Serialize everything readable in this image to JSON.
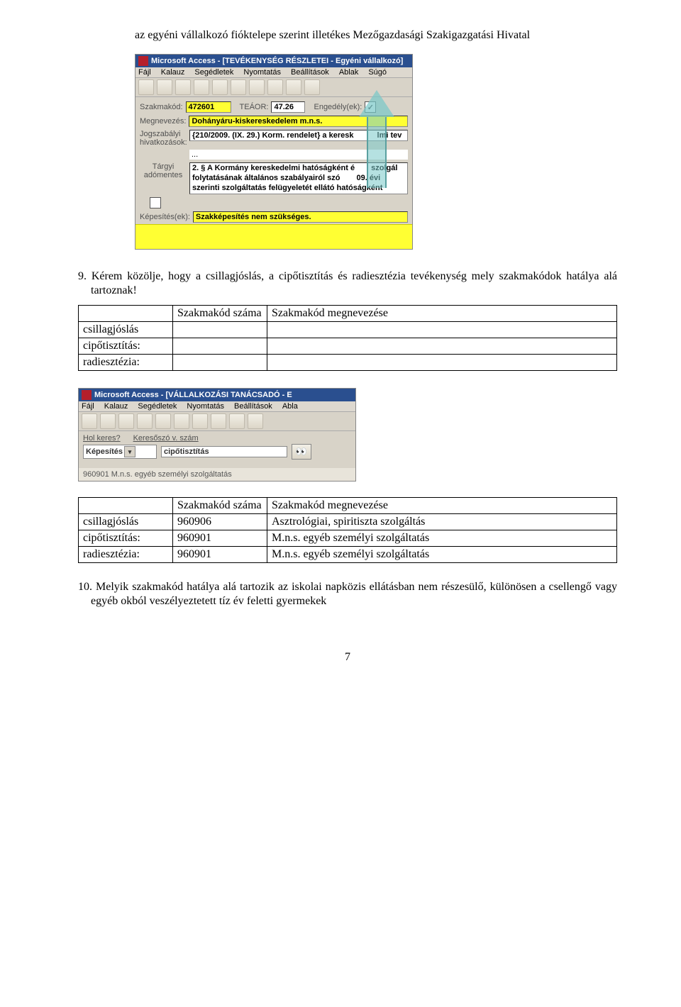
{
  "intro_line": "az egyéni vállalkozó fióktelepe szerint illetékes  Mezőgazdasági Szakigazgatási Hivatal",
  "q9": "9. Kérem közölje, hogy a csillagjóslás, a cipőtisztítás és radiesztézia tevékenység mely szakmakódok hatálya alá tartoznak!",
  "shot1": {
    "title": "Microsoft Access - [TEVÉKENYSÉG RÉSZLETEI - Egyéni vállalkozó]",
    "menu": [
      "Fájl",
      "Kalauz",
      "Segédletek",
      "Nyomtatás",
      "Beállítások",
      "Ablak",
      "Súgó"
    ],
    "labels": {
      "szakmakod": "Szakmakód:",
      "teaor": "TEÁOR:",
      "engedely": "Engedély(ek):",
      "megnevezes": "Megnevezés:",
      "jogszab": "Jogszabályi hivatkozások:",
      "targyi": "Tárgyi adómentes",
      "kepesites": "Képesítés(ek):"
    },
    "values": {
      "szakmakod": "472601",
      "teaor": "47.26",
      "check": "✓",
      "megnevezes": "Dohányáru-kiskereskedelem m.n.s.",
      "jogszab": "{210/2009. (IX. 29.) Korm. rendelet} a keresk",
      "jogszab_tail": "lmi tev",
      "targyi_text1": "2. § A Kormány kereskedelmi hatóságként é",
      "targyi_text1b": "szolgál",
      "targyi_text2": "folytatásának általános szabályairól szó",
      "targyi_text2b": "09. évi",
      "targyi_text3": "szerinti szolgáltatás felügyeletét ellátó hatóságként",
      "dots": "...",
      "kepesites": "Szakképesítés nem szükséges."
    }
  },
  "table1": {
    "h1": "Szakmakód száma",
    "h2": "Szakmakód megnevezése",
    "rows": [
      "csillagjóslás",
      "cipőtisztítás:",
      "radiesztézia:"
    ]
  },
  "shot2": {
    "title": "Microsoft Access - [VÁLLALKOZÁSI TANÁCSADÓ - E",
    "menu": [
      "Fájl",
      "Kalauz",
      "Segédletek",
      "Nyomtatás",
      "Beállítások",
      "Abla"
    ],
    "labels": {
      "hol": "Hol keres?",
      "kereso": "Keresőszó v. szám"
    },
    "values": {
      "hol": "Képesítés",
      "kereso": "cipőtisztítás"
    },
    "result": "960901  M.n.s. egyéb személyi szolgáltatás"
  },
  "table2": {
    "h1": "Szakmakód száma",
    "h2": "Szakmakód megnevezése",
    "rows": [
      {
        "name": "csillagjóslás",
        "code": "960906",
        "desc": "Asztrológiai, spiritiszta szolgáltás"
      },
      {
        "name": "cipőtisztítás:",
        "code": "960901",
        "desc": "M.n.s. egyéb személyi szolgáltatás"
      },
      {
        "name": "radiesztézia:",
        "code": "960901",
        "desc": "M.n.s. egyéb személyi szolgáltatás"
      }
    ]
  },
  "q10": "10. Melyik szakmakód hatálya alá tartozik az iskolai napközis ellátásban nem részesülő, különösen a csellengő vagy egyéb okból veszélyeztetett tíz év feletti gyermekek",
  "page": "7"
}
